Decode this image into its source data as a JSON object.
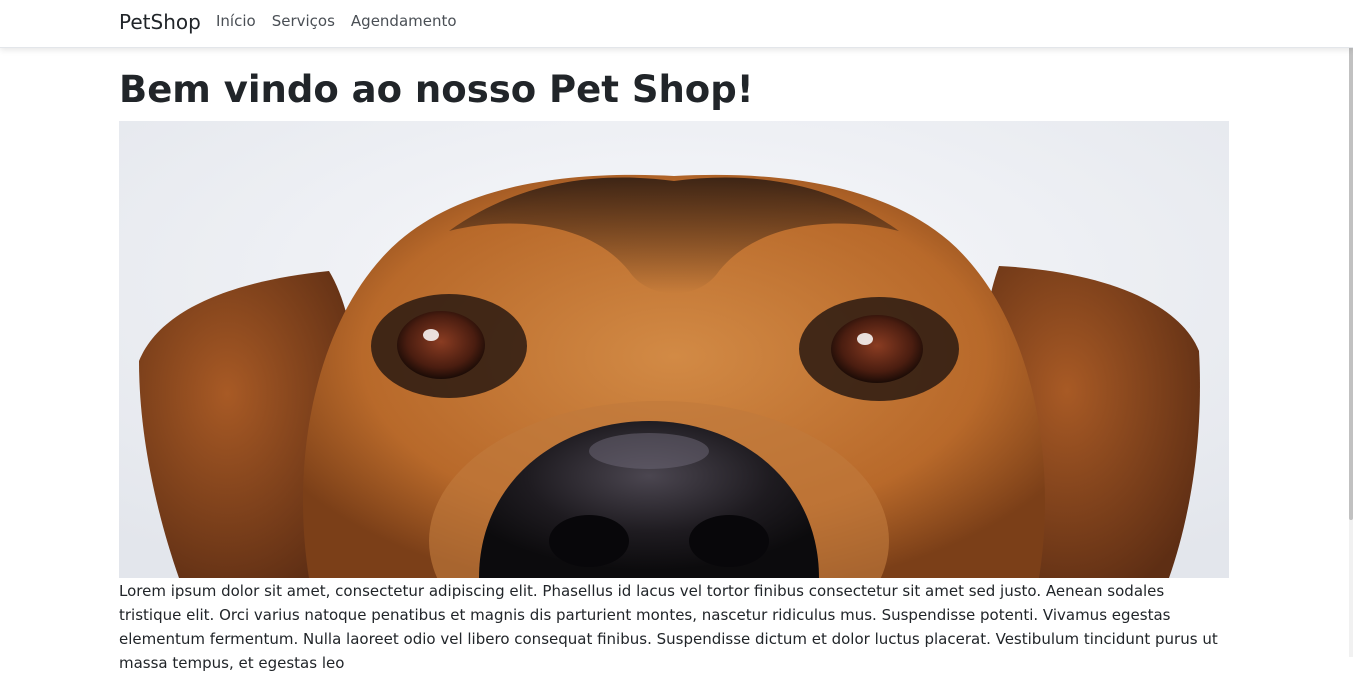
{
  "navbar": {
    "brand": "PetShop",
    "links": [
      {
        "label": "Início"
      },
      {
        "label": "Serviços"
      },
      {
        "label": "Agendamento"
      }
    ]
  },
  "main": {
    "title": "Bem vindo ao nosso Pet Shop!",
    "hero_image": {
      "subject": "close-up photo of a brown and black dog face"
    },
    "body_text": "Lorem ipsum dolor sit amet, consectetur adipiscing elit. Phasellus id lacus vel tortor finibus consectetur sit amet sed justo. Aenean sodales tristique elit. Orci varius natoque penatibus et magnis dis parturient montes, nascetur ridiculus mus. Suspendisse potenti. Vivamus egestas elementum fermentum. Nulla laoreet odio vel libero consequat finibus. Suspendisse dictum et dolor luctus placerat. Vestibulum tincidunt purus ut massa tempus, et egestas leo"
  },
  "colors": {
    "text": "#212529",
    "nav_link": "#4a4f55",
    "hero_background": "#eef0f4",
    "dog_fur": "#b8692a",
    "dog_dark": "#2a1a12"
  }
}
